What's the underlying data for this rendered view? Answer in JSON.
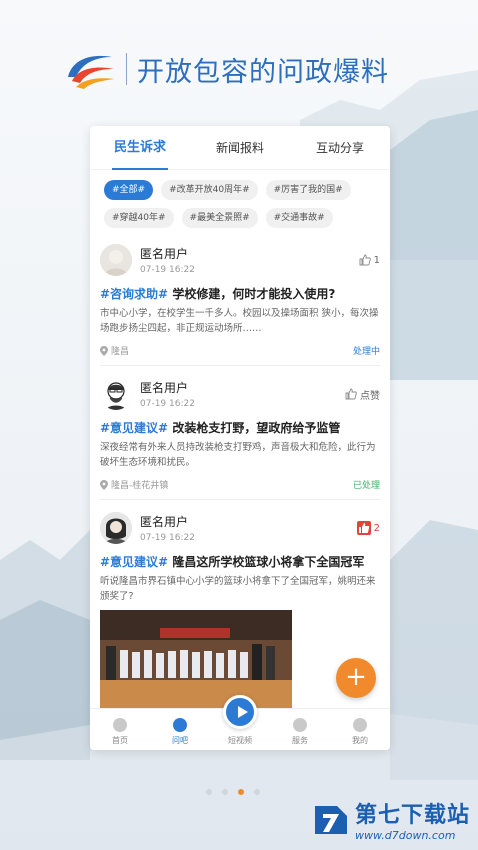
{
  "header": {
    "title": "开放包容的问政爆料"
  },
  "tabs": [
    {
      "label": "民生诉求",
      "active": true
    },
    {
      "label": "新闻报料",
      "active": false
    },
    {
      "label": "互动分享",
      "active": false
    }
  ],
  "tags": [
    "#全部#",
    "#改革开放40周年#",
    "#厉害了我的国#",
    "#穿越40年#",
    "#最美全景照#",
    "#交通事故#"
  ],
  "posts": [
    {
      "user": "匿名用户",
      "time": "07-19 16:22",
      "like": "1",
      "topic": "#咨询求助#",
      "title": "学校修建，何时才能投入使用?",
      "body": "市中心小学，在校学生一千多人。校园以及操场面积 狭小，每次操场跑步扬尘四起，非正规运动场所……",
      "location": "隆昌",
      "status": "处理中"
    },
    {
      "user": "匿名用户",
      "time": "07-19 16:22",
      "like": "点赞",
      "topic": "#意见建议#",
      "title": "改装枪支打野，望政府给予监管",
      "body": "深夜经常有外来人员持改装枪支打野鸡，声音极大和危险，此行为破坏生态环境和扰民。",
      "location": "隆昌-桂花井镇",
      "status": "已处理"
    },
    {
      "user": "匿名用户",
      "time": "07-19 16:22",
      "like": "2",
      "topic": "#意见建议#",
      "title": "隆昌这所学校篮球小将拿下全国冠军",
      "body": "听说隆昌市界石镇中心小学的篮球小将拿下了全国冠军，姚明还来颁奖了?"
    }
  ],
  "bottom_nav": [
    "首页",
    "问吧",
    "短视频",
    "服务",
    "我的"
  ],
  "fab": "+",
  "watermark": {
    "title": "第七下载站",
    "url": "www.d7down.com"
  },
  "colors": {
    "accent": "#2b7bd6",
    "orange": "#f08a2c",
    "green": "#3bb36a"
  }
}
